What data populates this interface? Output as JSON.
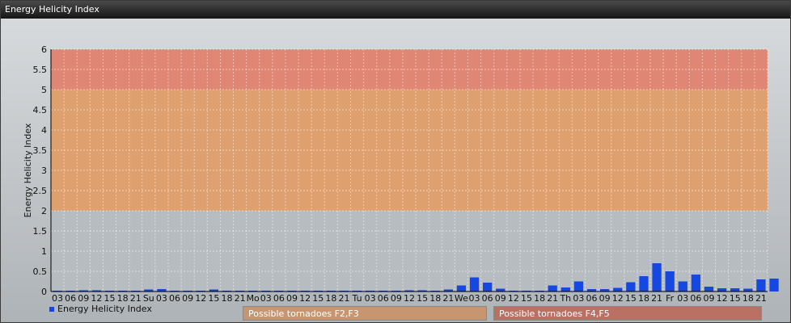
{
  "window": {
    "title": "Energy Helicity Index"
  },
  "chart_data": {
    "type": "bar",
    "title": "",
    "xlabel": "",
    "ylabel": "Energy Helicity Index",
    "ylim": [
      0,
      6
    ],
    "yticks": [
      "0",
      "0.5",
      "1",
      "1.5",
      "2",
      "2.5",
      "3",
      "3.5",
      "4",
      "4.5",
      "5",
      "5.5",
      "6"
    ],
    "categories": [
      "03",
      "06",
      "09",
      "12",
      "15",
      "18",
      "21",
      "Su",
      "03",
      "06",
      "09",
      "12",
      "15",
      "18",
      "21",
      "Mo",
      "03",
      "06",
      "09",
      "12",
      "15",
      "18",
      "21",
      "Tu",
      "03",
      "06",
      "09",
      "12",
      "15",
      "18",
      "21",
      "We",
      "03",
      "06",
      "09",
      "12",
      "15",
      "18",
      "21",
      "Th",
      "03",
      "06",
      "09",
      "12",
      "15",
      "18",
      "21",
      "Fr",
      "03",
      "06",
      "09",
      "12",
      "15",
      "18",
      "21"
    ],
    "series": [
      {
        "name": "Energy Helicity Index",
        "color": "#1448e0",
        "values": [
          0.02,
          0.02,
          0.03,
          0.03,
          0.02,
          0.02,
          0.02,
          0.05,
          0.06,
          0.02,
          0.02,
          0.02,
          0.05,
          0.02,
          0.02,
          0.02,
          0.02,
          0.02,
          0.02,
          0.02,
          0.02,
          0.02,
          0.02,
          0.02,
          0.02,
          0.02,
          0.02,
          0.03,
          0.03,
          0.02,
          0.05,
          0.15,
          0.35,
          0.22,
          0.07,
          0.02,
          0.02,
          0.02,
          0.15,
          0.1,
          0.25,
          0.06,
          0.06,
          0.09,
          0.23,
          0.38,
          0.7,
          0.5,
          0.25,
          0.42,
          0.12,
          0.08,
          0.08,
          0.07,
          0.3,
          0.32
        ]
      }
    ],
    "bands": [
      {
        "from": 2,
        "to": 5,
        "label": "Possible tornadoes F2,F3",
        "color": "#e8995a"
      },
      {
        "from": 5,
        "to": 6,
        "label": "Possible tornadoes F4,F5",
        "color": "#ea7860"
      }
    ],
    "grid": true,
    "legend_position": "bottom-left"
  }
}
